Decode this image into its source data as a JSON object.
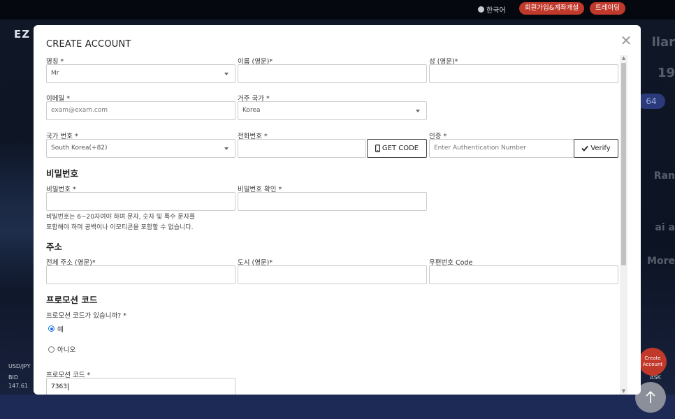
{
  "background": {
    "language": "한국어",
    "signup_button": "회원가입&계좌개설",
    "trade_button": "트레이딩",
    "logo": "EZ",
    "ticker_pair": "USD/JPY",
    "ticker_bid_label": "BID",
    "ticker_bid_value": "147.61",
    "ticker_ask_label": "ASK",
    "right_fragments": [
      "llar",
      "19",
      "64",
      "Ran",
      "ai a",
      "More"
    ],
    "create_account_fab": "Create Account",
    "brand_color": "#c0392b"
  },
  "modal": {
    "title": "CREATE ACCOUNT",
    "close_icon": "close-icon",
    "fields": {
      "title_label": "명칭 *",
      "title_value": "Mr",
      "first_name_label": "이름 (영문)*",
      "last_name_label": "성 (영문)*",
      "email_label": "이메일 *",
      "email_placeholder": "exam@exam.com",
      "country_label": "거주 국가 *",
      "country_value": "Korea",
      "country_code_label": "국가 번호 *",
      "country_code_value": "South Korea(+82)",
      "phone_label": "전화번호 *",
      "get_code_button": "GET CODE",
      "auth_label": "인증 *",
      "auth_placeholder": "Enter Authentication Number",
      "verify_button": "Verify"
    },
    "password": {
      "section_title": "비밀번호",
      "password_label": "비밀번호 *",
      "confirm_label": "비밀번호 확인 *",
      "hint_line1": "비밀번호는 6~20자여야 하며 문자, 숫자 및 특수 문자를",
      "hint_line2": "포함해야 하며 공백이나 이모티콘을 포함할 수 없습니다."
    },
    "address": {
      "section_title": "주소",
      "full_address_label": "전체 주소 (영문)*",
      "city_label": "도시 (영문)*",
      "postal_label": "우편번호 Code"
    },
    "promo": {
      "section_title": "프로모션 코드",
      "question": "프로모션 코드가 있습니까? *",
      "yes_label": "예",
      "no_label": "아니오",
      "selected": "yes",
      "code_label": "프로모션 코드 *",
      "code_value": "7363"
    }
  }
}
